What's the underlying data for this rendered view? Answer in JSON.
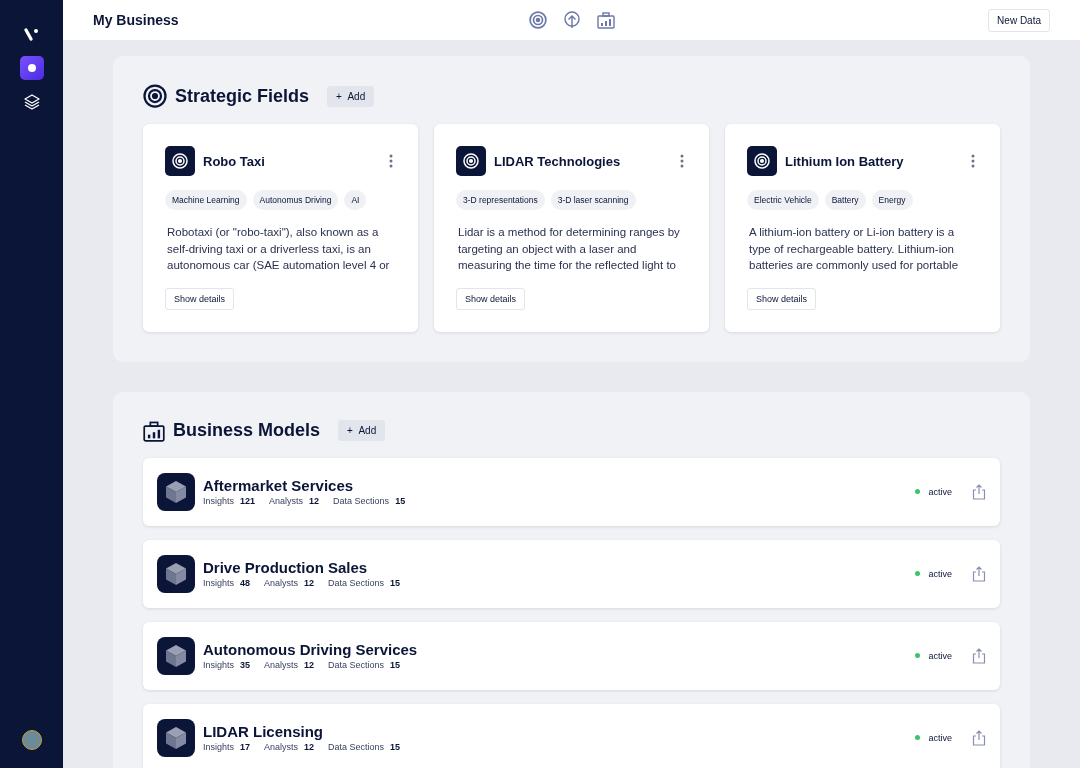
{
  "sidebar": {
    "items": [
      {
        "kind": "logo",
        "selected": false
      },
      {
        "kind": "dot",
        "selected": true
      },
      {
        "kind": "layers",
        "selected": false
      }
    ]
  },
  "header": {
    "title": "My Business",
    "nav_icons": [
      {
        "kind": "target",
        "selected": false
      },
      {
        "kind": "upload",
        "selected": false
      },
      {
        "kind": "briefcase",
        "selected": false
      }
    ],
    "button": "New Data"
  },
  "strategic_fields": {
    "title": "Strategic Fields",
    "add_button": "Add",
    "add_symbol": "+",
    "cards": [
      {
        "title": "Robo Taxi",
        "tags": [
          "Machine Learning",
          "Autonomus Driving",
          "AI"
        ],
        "description": "Robotaxi (or \"robo-taxi\"), also known as a self-driving taxi or a driverless taxi, is an autonomous car (SAE automation level 4 or",
        "button": "Show details"
      },
      {
        "title": "LIDAR Technologies",
        "tags": [
          "3-D representations",
          "3-D laser scanning"
        ],
        "description": "Lidar is a method for determining ranges by targeting an object with a laser and measuring the time for the reflected light to",
        "button": "Show details"
      },
      {
        "title": "Lithium Ion Battery",
        "tags": [
          "Electric Vehicle",
          "Battery",
          "Energy"
        ],
        "description": "A lithium-ion battery or Li-ion battery is a type of rechargeable battery. Lithium-ion batteries are commonly used for portable",
        "button": "Show details"
      }
    ]
  },
  "business_models": {
    "title": "Business Models",
    "add_button": "Add",
    "add_symbol": "+",
    "rows": [
      {
        "title": "Aftermarket Services",
        "stats": [
          {
            "label": "Insights",
            "value": "121"
          },
          {
            "label": "Analysts",
            "value": "12"
          },
          {
            "label": "Data Sections",
            "value": "15"
          }
        ],
        "status": "active",
        "color": "#3cc36e"
      },
      {
        "title": "Drive Production Sales",
        "stats": [
          {
            "label": "Insights",
            "value": "48"
          },
          {
            "label": "Analysts",
            "value": "12"
          },
          {
            "label": "Data Sections",
            "value": "15"
          }
        ],
        "status": "active",
        "color": "#3cc36e"
      },
      {
        "title": "Autonomous Driving Services",
        "stats": [
          {
            "label": "Insights",
            "value": "35"
          },
          {
            "label": "Analysts",
            "value": "12"
          },
          {
            "label": "Data Sections",
            "value": "15"
          }
        ],
        "status": "active",
        "color": "#3cc36e"
      },
      {
        "title": "LIDAR Licensing",
        "stats": [
          {
            "label": "Insights",
            "value": "17"
          },
          {
            "label": "Analysts",
            "value": "12"
          },
          {
            "label": "Data Sections",
            "value": "15"
          }
        ],
        "status": "active",
        "color": "#3cc36e"
      }
    ]
  }
}
